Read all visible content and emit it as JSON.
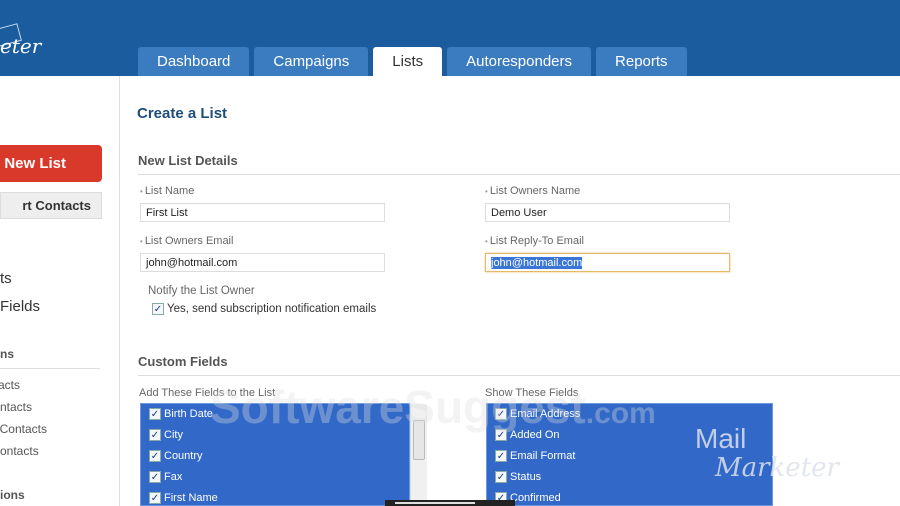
{
  "header": {
    "logo_text": "eter",
    "tabs": [
      "Dashboard",
      "Campaigns",
      "Lists",
      "Autoresponders",
      "Reports"
    ],
    "active_tab": "Lists"
  },
  "sidebar": {
    "new_list": "New List",
    "import_contacts": "rt Contacts",
    "items_big": [
      "ts",
      "Fields"
    ],
    "section1": "ns",
    "items": [
      "acts",
      "ntacts",
      "Contacts",
      "ontacts"
    ],
    "section2": "ions"
  },
  "page": {
    "title": "Create a List"
  },
  "details": {
    "heading": "New List Details",
    "list_name_label": "List Name",
    "list_name": "First List",
    "owners_name_label": "List Owners Name",
    "owners_name": "Demo User",
    "owners_email_label": "List Owners Email",
    "owners_email": "john@hotmail.com",
    "reply_to_label": "List Reply-To Email",
    "reply_to": "john@hotmail.com",
    "notify_label": "Notify the List Owner",
    "notify_checkbox": "Yes, send subscription notification emails"
  },
  "custom_fields": {
    "heading": "Custom Fields",
    "add_label": "Add These Fields to the List",
    "add_items": [
      "Birth Date",
      "City",
      "Country",
      "Fax",
      "First Name"
    ],
    "show_label": "Show These Fields",
    "show_items": [
      "Email Address",
      "Added On",
      "Email Format",
      "Status",
      "Confirmed"
    ]
  },
  "watermark": {
    "text": "SoftwareSuggest",
    "suffix": ".com",
    "logo_line1": "Mail",
    "logo_line2": "Marketer"
  },
  "colors": {
    "header": "#1b5c9e",
    "tab": "#3b7cc1",
    "new_list": "#d9392b",
    "listbox": "#3268c8"
  }
}
